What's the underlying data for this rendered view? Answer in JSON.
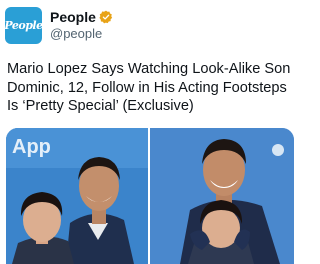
{
  "account": {
    "avatar_text": "People",
    "display_name": "People",
    "handle": "@people",
    "verified": true,
    "avatar_color": "#2a9fd6",
    "verified_color": "#e8a317"
  },
  "tweet": {
    "text": "Mario Lopez Says Watching Look-Alike Son Dominic, 12, Follow in His Acting Footsteps Is ‘Pretty Special’ (Exclusive)"
  },
  "media": {
    "left_photo_sign_text": "App",
    "photos": [
      "photo-left",
      "photo-right"
    ]
  }
}
